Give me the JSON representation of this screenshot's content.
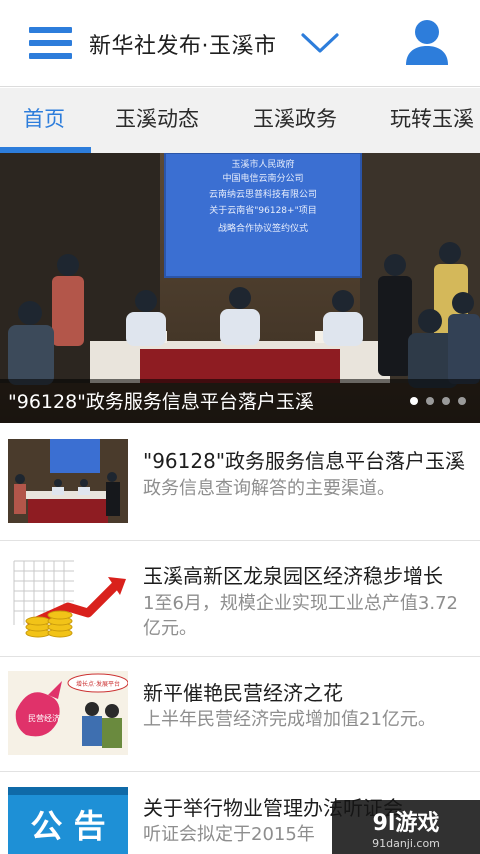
{
  "header": {
    "title": "新华社发布·玉溪市"
  },
  "tabs": [
    {
      "label": "首页",
      "active": true
    },
    {
      "label": "玉溪动态",
      "active": false
    },
    {
      "label": "玉溪政务",
      "active": false
    },
    {
      "label": "玉溪",
      "prefix": "玩转",
      "active": false
    }
  ],
  "tabs_text": {
    "t0": "首页",
    "t1": "玉溪动态",
    "t2": "玉溪政务",
    "t3": "玩转玉溪"
  },
  "banner": {
    "caption": "\"96128\"政务服务信息平台落户玉溪",
    "slide_count": 4,
    "active_slide": 1,
    "photo_text": {
      "line1": "玉溪市人民政府",
      "line2": "中国电信云南分公司",
      "line3": "云南纳云思普科技有限公司",
      "line4": "关于云南省\"96128+\"项目",
      "line5": "战略合作协议签约仪式"
    }
  },
  "news": [
    {
      "title": "\"96128\"政务服务信息平台落户玉溪",
      "summary": "政务信息查询解答的主要渠道。"
    },
    {
      "title": "玉溪高新区龙泉园区经济稳步增长",
      "summary": "1至6月，规模企业实现工业总产值3.72亿元。"
    },
    {
      "title": "新平催艳民营经济之花",
      "summary": "上半年民营经济完成增加值21亿元。",
      "thumb_text": {
        "bubble": "增长点·发展平台",
        "label": "民营经济"
      }
    },
    {
      "title": "关于举行物业管理办法听证会",
      "summary": "听证会拟定于2015年",
      "thumb_text": {
        "label": "公 告"
      }
    }
  ],
  "watermark": {
    "brand": "9l游戏",
    "site": "91danji.com"
  },
  "colors": {
    "accent": "#2d7ddb",
    "tab_bg": "#f1f1f1"
  }
}
